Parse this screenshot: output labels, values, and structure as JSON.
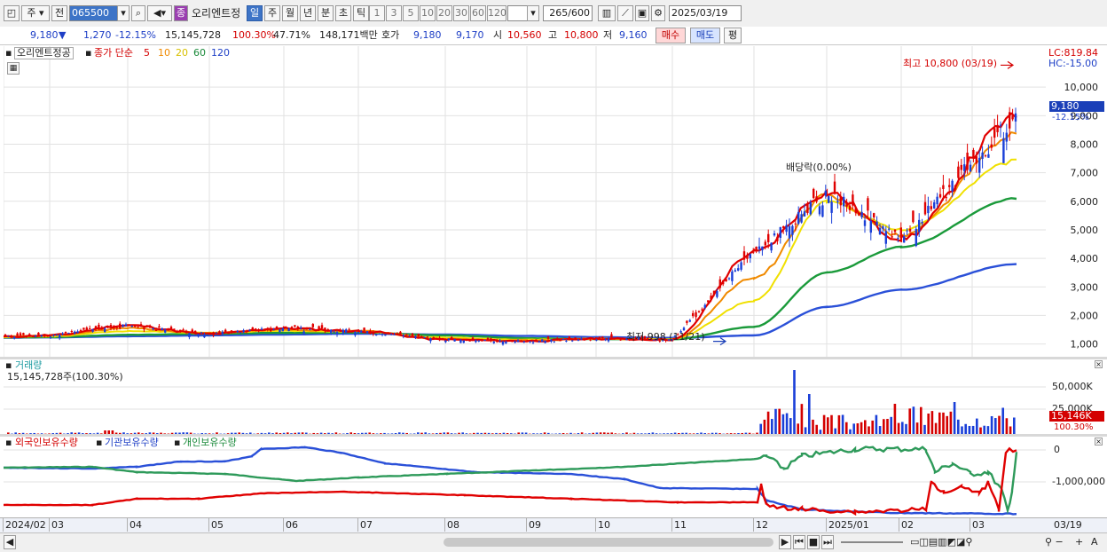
{
  "toolbar": {
    "period_unit": "주",
    "prev_label": "전",
    "code": "065500",
    "stock_name": "오리엔트정",
    "badge": "종",
    "period_tabs": [
      "일",
      "주",
      "월",
      "년",
      "분",
      "초",
      "틱"
    ],
    "interval_buttons": [
      "1",
      "3",
      "5",
      "10",
      "20",
      "30",
      "60",
      "120"
    ],
    "count_value": "265",
    "count_max": "/600",
    "date_value": "2025/03/19"
  },
  "quote": {
    "price": "9,180",
    "change_arrow": "▼",
    "change": "1,270",
    "change_pct": "-12.15%",
    "volume": "15,145,728",
    "volume_ratio": "100.30%",
    "turnover": "47.71%",
    "amount": "148,171백만",
    "hoga_label": "호가",
    "ask": "9,180",
    "bid": "9,170",
    "open_label": "시",
    "open": "10,560",
    "high_label": "고",
    "high": "10,800",
    "low_label": "저",
    "low": "9,160",
    "buy_label": "매수",
    "sell_label": "매도",
    "avg_label": "평"
  },
  "price_panel": {
    "title": "오리엔트정공",
    "ma_label": "종가 단순",
    "ma_periods": [
      "5",
      "10",
      "20",
      "60",
      "120"
    ],
    "lc_label": "LC:819.84",
    "hc_label": "HC:-15.00",
    "high_annotation": "최고 10,800 (03/19)",
    "low_annotation": "최저 998 (11/21)",
    "dividend_annotation": "배당락(0.00%)",
    "current_price_tag": "9,180",
    "current_pct_tag": "-12.15%",
    "y_ticks": [
      "10,000",
      "9,000",
      "8,000",
      "7,000",
      "6,000",
      "5,000",
      "4,000",
      "3,000",
      "2,000",
      "1,000"
    ]
  },
  "volume_panel": {
    "title": "거래량",
    "value_label": "15,145,728주(100.30%)",
    "y_ticks": [
      "50,000K",
      "25,000K"
    ],
    "current_tag": "15,146K",
    "current_pct": "100.30%"
  },
  "holdings_panel": {
    "series_labels": [
      "외국인보유수량",
      "기관보유수량",
      "개인보유수량"
    ],
    "y_ticks": [
      "0",
      "-1,000,000"
    ]
  },
  "x_axis": {
    "labels": [
      "2024/02",
      "03",
      "04",
      "05",
      "06",
      "07",
      "08",
      "09",
      "10",
      "11",
      "12",
      "2025/01",
      "02",
      "03"
    ],
    "right_label": "03/19"
  },
  "colors": {
    "ma5": "#e00000",
    "ma10": "#f08a00",
    "ma20": "#f0e000",
    "ma60": "#1a9a3a",
    "ma120": "#2a50d8",
    "foreign": "#e00000",
    "institution": "#2a50d8",
    "individual": "#2e9a5a"
  },
  "chart_data": {
    "type": "line",
    "title": "오리엔트정공",
    "ylabel": "",
    "ylim": [
      800,
      11000
    ],
    "categories": [
      "2024/02",
      "03",
      "04",
      "05",
      "06",
      "07",
      "08",
      "09",
      "10",
      "11",
      "12",
      "2025/01",
      "02",
      "03"
    ],
    "series": [
      {
        "name": "5",
        "values": [
          1250,
          1300,
          1650,
          1350,
          1550,
          1450,
          1150,
          1100,
          1180,
          1150,
          4200,
          6300,
          4700,
          8900
        ]
      },
      {
        "name": "10",
        "values": [
          1250,
          1290,
          1550,
          1380,
          1500,
          1450,
          1180,
          1120,
          1180,
          1160,
          3300,
          6200,
          4800,
          8300
        ]
      },
      {
        "name": "20",
        "values": [
          1240,
          1270,
          1450,
          1400,
          1460,
          1430,
          1220,
          1150,
          1180,
          1170,
          2500,
          6000,
          5000,
          7400
        ]
      },
      {
        "name": "60",
        "values": [
          1230,
          1240,
          1320,
          1360,
          1390,
          1400,
          1300,
          1200,
          1170,
          1160,
          1600,
          3500,
          4400,
          6100
        ]
      },
      {
        "name": "120",
        "values": [
          1220,
          1230,
          1270,
          1300,
          1330,
          1360,
          1330,
          1280,
          1240,
          1210,
          1300,
          2300,
          2900,
          3800
        ]
      }
    ]
  }
}
